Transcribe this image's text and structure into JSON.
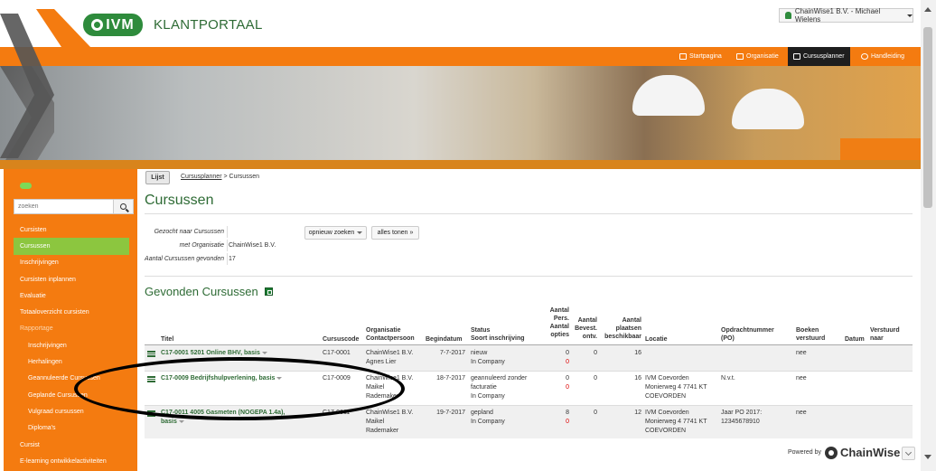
{
  "brand": {
    "logo_text": "IVM",
    "portal_title": "KLANTPORTAAL"
  },
  "user_menu": {
    "label": "ChainWise1 B.V. - Michael Wielens"
  },
  "nav": [
    {
      "label": "Startpagina",
      "icon": "home-icon",
      "active": false
    },
    {
      "label": "Organisatie",
      "icon": "users-icon",
      "active": false
    },
    {
      "label": "Cursusplanner",
      "icon": "calendar-icon",
      "active": true
    },
    {
      "label": "Handleiding",
      "icon": "help-icon",
      "active": false
    }
  ],
  "sidebar": {
    "search_placeholder": "zoeken",
    "items": [
      {
        "label": "Cursisten"
      },
      {
        "label": "Cursussen"
      },
      {
        "label": "Inschrijvingen"
      },
      {
        "label": "Cursisten inplannen"
      },
      {
        "label": "Evaluatie"
      },
      {
        "label": "Totaaloverzicht cursisten"
      },
      {
        "label": "Rapportage"
      },
      {
        "label": "Inschrijvingen"
      },
      {
        "label": "Herhalingen"
      },
      {
        "label": "Geannuleerde Cursussen"
      },
      {
        "label": "Geplande Cursussen"
      },
      {
        "label": "Vulgraad cursussen"
      },
      {
        "label": "Diploma's"
      },
      {
        "label": "Cursist"
      },
      {
        "label": "E-learning ontwikkelactiviteiten"
      }
    ]
  },
  "content": {
    "tab_label": "Lijst",
    "breadcrumb_link": "Cursusplanner",
    "breadcrumb_sep": " > ",
    "breadcrumb_current": "Cursussen",
    "title": "Cursussen",
    "filters": [
      {
        "label": "Gezocht naar Cursussen",
        "value": ""
      },
      {
        "label": "met Organisatie",
        "value": "ChainWise1 B.V."
      },
      {
        "label": "Aantal Cursussen gevonden",
        "value": "17"
      }
    ],
    "btn_search_again": "opnieuw zoeken",
    "btn_show_all": "alles tonen »",
    "found_title": "Gevonden Cursussen"
  },
  "table": {
    "headers": {
      "titel": "Titel",
      "cursuscode": "Cursuscode",
      "organisatie": [
        "Organisatie",
        "Contactpersoon"
      ],
      "begindatum": "Begindatum",
      "status": [
        "Status",
        "Soort inschrijving"
      ],
      "aantal_opties": [
        "Aantal",
        "Pers.",
        "Aantal",
        "opties"
      ],
      "bevest": [
        "Aantal",
        "Bevest.",
        "ontv."
      ],
      "plaatsen": [
        "Aantal",
        "plaatsen",
        "beschikbaar"
      ],
      "locatie": "Locatie",
      "opdrachtnummer": [
        "Opdrachtnummer",
        "(PO)"
      ],
      "boeken": [
        "Boeken",
        "verstuurd"
      ],
      "datum": "Datum",
      "verstuurd_naar": [
        "Verstuurd",
        "naar"
      ]
    },
    "rows": [
      {
        "titel": [
          "C17-0001 5201 Online BHV, basis"
        ],
        "code": "C17-0001",
        "org": [
          "ChainWise1 B.V.",
          "Agnes Lier"
        ],
        "begin": "7-7-2017",
        "status": [
          "nieuw",
          "In Company"
        ],
        "opties": [
          "0",
          "0"
        ],
        "bevest": "0",
        "plaatsen": "16",
        "locatie": [],
        "po": [],
        "boeken": "nee"
      },
      {
        "titel": [
          "C17-0009 Bedrijfshulpverlening, basis"
        ],
        "code": "C17-0009",
        "org": [
          "ChainWise1 B.V.",
          "Maikel",
          "Rademaker"
        ],
        "begin": "18-7-2017",
        "status": [
          "geannuleerd zonder",
          "facturatie",
          "In Company"
        ],
        "opties": [
          "0",
          "0"
        ],
        "bevest": "0",
        "plaatsen": "16",
        "locatie": [
          "IVM Coevorden",
          "Monierweg 4 7741 KT",
          "COEVORDEN"
        ],
        "po": [
          "N.v.t."
        ],
        "boeken": "nee"
      },
      {
        "titel": [
          "C17-0011 4005 Gasmeten (NOGEPA 1.4a),",
          "basis"
        ],
        "code": "C17-0011",
        "org": [
          "ChainWise1 B.V.",
          "Maikel",
          "Rademaker"
        ],
        "begin": "19-7-2017",
        "status": [
          "gepland",
          "In Company"
        ],
        "opties": [
          "8",
          "0"
        ],
        "bevest": "0",
        "plaatsen": "12",
        "locatie": [
          "IVM Coevorden",
          "Monierweg 4 7741 KT",
          "COEVORDEN"
        ],
        "po": [
          "Jaar PO 2017:",
          "12345678910"
        ],
        "boeken": "nee"
      }
    ]
  },
  "footer": {
    "powered_by": "Powered by",
    "brand": "ChainWise"
  }
}
